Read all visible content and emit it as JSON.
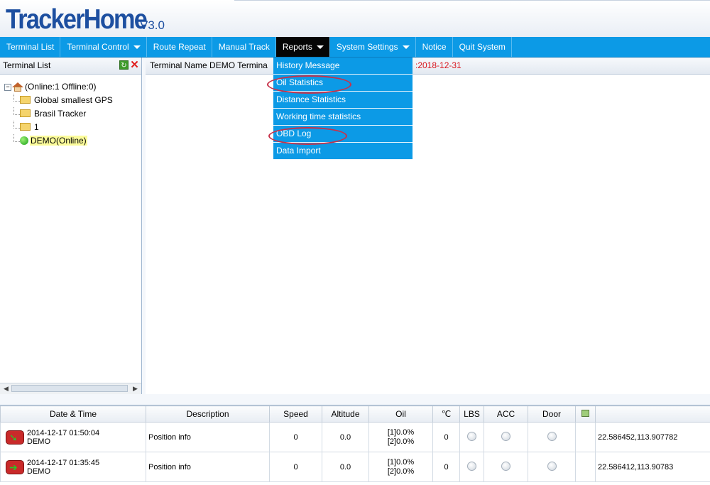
{
  "app": {
    "logo": "TrackerHome",
    "version": "V3.0"
  },
  "nav": {
    "items": [
      {
        "label": "Terminal List",
        "dropdown": false,
        "active": false
      },
      {
        "label": "Terminal Control",
        "dropdown": true,
        "active": false
      },
      {
        "label": "Route Repeat",
        "dropdown": false,
        "active": false
      },
      {
        "label": "Manual Track",
        "dropdown": false,
        "active": false
      },
      {
        "label": "Reports",
        "dropdown": true,
        "active": true
      },
      {
        "label": "System Settings",
        "dropdown": true,
        "active": false
      },
      {
        "label": "Notice",
        "dropdown": false,
        "active": false
      },
      {
        "label": "Quit System",
        "dropdown": false,
        "active": false
      }
    ]
  },
  "reports_menu": {
    "items": [
      "History Message",
      "Oil Statistics",
      "Distance Statistics",
      "Working time statistics",
      "OBD Log",
      "Data Import"
    ],
    "circled": [
      "Oil Statistics",
      "OBD Log"
    ]
  },
  "sidebar": {
    "title": "Terminal List",
    "root_label": "(Online:1   Offline:0)",
    "groups": [
      "Global smallest GPS",
      "Brasil Tracker",
      "1"
    ],
    "device": "DEMO(Online)"
  },
  "main": {
    "header_text": "Terminal Name  DEMO    Termina",
    "date_range": ":2018-12-31"
  },
  "grid": {
    "columns": [
      "Date & Time",
      "Description",
      "Speed",
      "Altitude",
      "Oil",
      "℃",
      "LBS",
      "ACC",
      "Door",
      "",
      ""
    ],
    "rows": [
      {
        "datetime": "2014-12-17 01:50:04",
        "terminal": "DEMO",
        "description": "Position info",
        "speed": "0",
        "altitude": "0.0",
        "oil1": "[1]0.0%",
        "oil2": "[2]0.0%",
        "temp": "0",
        "coords": "22.586452,113.907782",
        "direction": "sw"
      },
      {
        "datetime": "2014-12-17 01:35:45",
        "terminal": "DEMO",
        "description": "Position info",
        "speed": "0",
        "altitude": "0.0",
        "oil1": "[1]0.0%",
        "oil2": "[2]0.0%",
        "temp": "0",
        "coords": "22.586412,113.90783",
        "direction": "e"
      }
    ]
  },
  "colors": {
    "nav_bg": "#0c9ae6",
    "nav_active": "#050505",
    "logo": "#1d4fa0",
    "date_red": "#d9141c",
    "circle": "#c7324a"
  }
}
